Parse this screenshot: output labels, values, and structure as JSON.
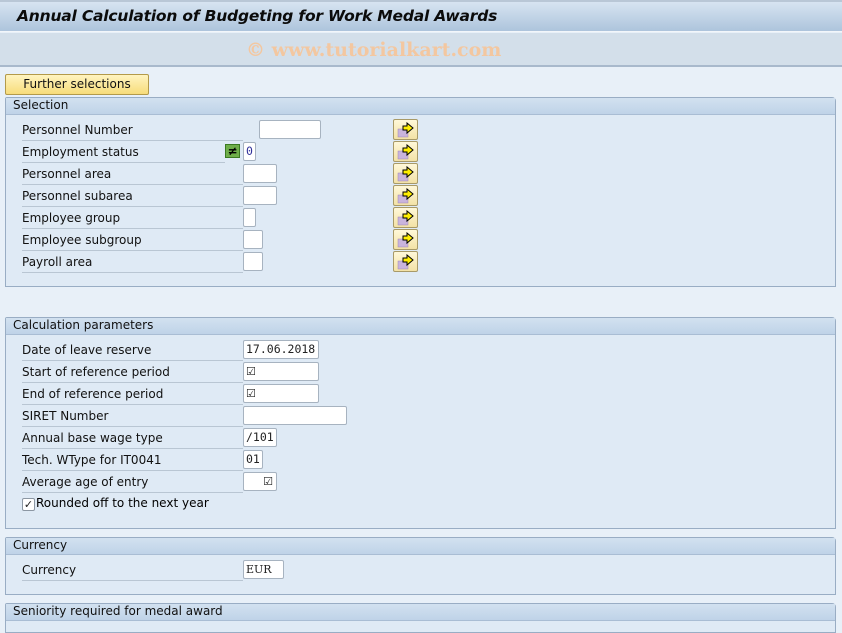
{
  "window": {
    "title": "Annual Calculation of Budgeting for Work Medal Awards",
    "watermark": "© www.tutorialkart.com"
  },
  "toolbar": {
    "further_selections_label": "Further selections"
  },
  "selection": {
    "header": "Selection",
    "rows": [
      {
        "label": "Personnel Number",
        "value": ""
      },
      {
        "label": "Employment status",
        "value": "0",
        "exclude_icon": "≠"
      },
      {
        "label": "Personnel area",
        "value": ""
      },
      {
        "label": "Personnel subarea",
        "value": ""
      },
      {
        "label": "Employee group",
        "value": ""
      },
      {
        "label": "Employee subgroup",
        "value": ""
      },
      {
        "label": "Payroll area",
        "value": ""
      }
    ],
    "multiple_selection_icon": "arrow-right-icon"
  },
  "calculation": {
    "header": "Calculation parameters",
    "rows": [
      {
        "label": "Date of leave reserve",
        "value": "17.06.2018"
      },
      {
        "label": "Start of reference period",
        "value": "☑"
      },
      {
        "label": "End of reference period",
        "value": "☑"
      },
      {
        "label": "SIRET Number",
        "value": ""
      },
      {
        "label": "Annual base wage type",
        "value": "/101"
      },
      {
        "label": "Tech. WType for IT0041",
        "value": "01"
      },
      {
        "label": "Average age of entry",
        "value": "☑"
      }
    ],
    "rounded_checkbox": {
      "label": "Rounded off to the next year",
      "checked": true,
      "mark": "✓"
    }
  },
  "currency": {
    "header": "Currency",
    "label": "Currency",
    "value": "EUR"
  },
  "seniority": {
    "header": "Seniority required for medal award"
  }
}
